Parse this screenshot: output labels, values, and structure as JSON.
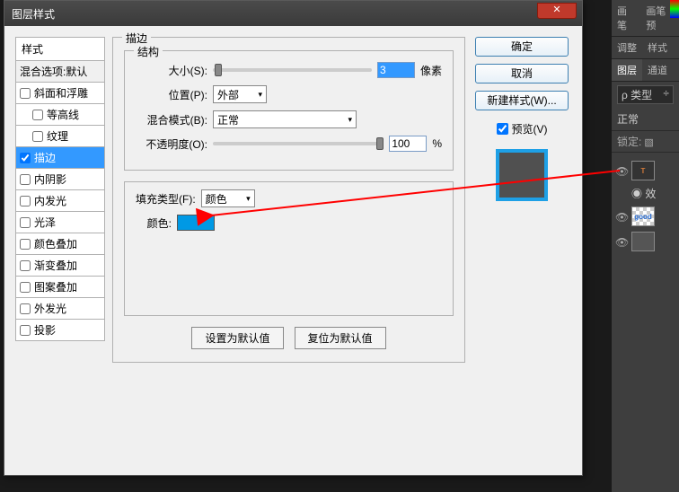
{
  "dialog": {
    "title": "图层样式",
    "styles_header": "样式",
    "blend_options": "混合选项:默认",
    "items": [
      {
        "label": "斜面和浮雕",
        "checked": false
      },
      {
        "label": "等高线",
        "checked": false
      },
      {
        "label": "纹理",
        "checked": false
      },
      {
        "label": "描边",
        "checked": true,
        "selected": true
      },
      {
        "label": "内阴影",
        "checked": false
      },
      {
        "label": "内发光",
        "checked": false
      },
      {
        "label": "光泽",
        "checked": false
      },
      {
        "label": "颜色叠加",
        "checked": false
      },
      {
        "label": "渐变叠加",
        "checked": false
      },
      {
        "label": "图案叠加",
        "checked": false
      },
      {
        "label": "外发光",
        "checked": false
      },
      {
        "label": "投影",
        "checked": false
      }
    ]
  },
  "stroke": {
    "group_title": "描边",
    "struct_title": "结构",
    "size_label": "大小(S):",
    "size_value": "3",
    "size_unit": "像素",
    "position_label": "位置(P):",
    "position_value": "外部",
    "blend_label": "混合模式(B):",
    "blend_value": "正常",
    "opacity_label": "不透明度(O):",
    "opacity_value": "100",
    "opacity_unit": "%",
    "fill_title": "填充类型(F):",
    "fill_value": "颜色",
    "color_label": "颜色:",
    "color_hex": "#0099e5",
    "btn_default": "设置为默认值",
    "btn_reset": "复位为默认值"
  },
  "buttons": {
    "ok": "确定",
    "cancel": "取消",
    "new_style": "新建样式(W)...",
    "preview": "预览(V)"
  },
  "side": {
    "tabs1": [
      "画笔",
      "画笔预"
    ],
    "tabs2": [
      "调整",
      "样式"
    ],
    "tabs3": [
      "图层",
      "通道"
    ],
    "kind": "类型",
    "mode": "正常",
    "lock": "锁定:",
    "layers": [
      {
        "type": "T",
        "label": ""
      },
      {
        "type": "fx",
        "label": "效"
      },
      {
        "type": "good",
        "label": "good"
      },
      {
        "type": "solid",
        "label": ""
      }
    ]
  }
}
